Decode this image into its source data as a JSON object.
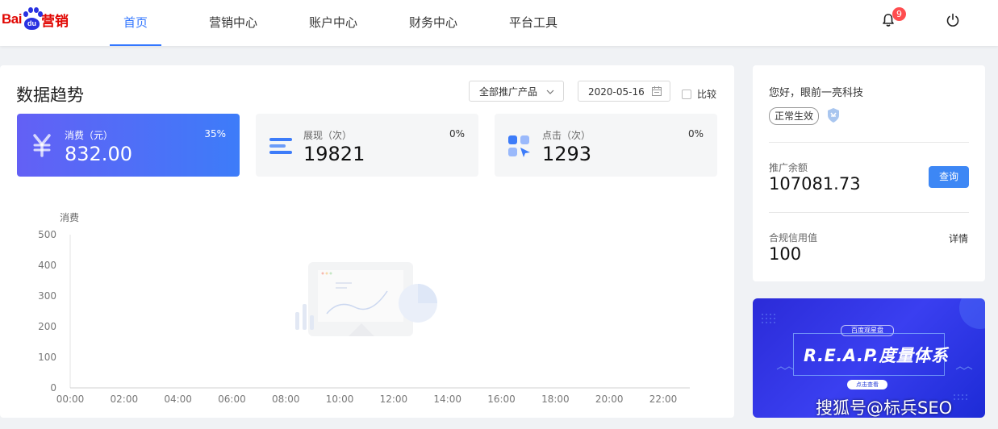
{
  "brand": {
    "logo_bai": "Bai",
    "logo_du": "du",
    "logo_cn": "营销"
  },
  "nav": {
    "items": [
      {
        "label": "首页",
        "active": true
      },
      {
        "label": "营销中心",
        "active": false
      },
      {
        "label": "账户中心",
        "active": false
      },
      {
        "label": "财务中心",
        "active": false
      },
      {
        "label": "平台工具",
        "active": false
      }
    ]
  },
  "header": {
    "notification_count": "9",
    "icons": [
      "bell-icon",
      "power-icon"
    ]
  },
  "trend": {
    "title": "数据趋势",
    "product_select": "全部推广产品",
    "date": "2020-05-16",
    "compare_label": "比较",
    "compare_checked": false
  },
  "cards": [
    {
      "label": "消费（元）",
      "value": "832.00",
      "percent": "35%",
      "icon": "yen-icon"
    },
    {
      "label": "展现（次）",
      "value": "19821",
      "percent": "0%",
      "icon": "list-icon"
    },
    {
      "label": "点击（次）",
      "value": "1293",
      "percent": "0%",
      "icon": "click-icon"
    }
  ],
  "chart_data": {
    "type": "line",
    "ylabel": "消费",
    "ylim": [
      0,
      500
    ],
    "yticks": [
      "0",
      "100",
      "200",
      "300",
      "400",
      "500"
    ],
    "categories": [
      "00:00",
      "02:00",
      "04:00",
      "06:00",
      "08:00",
      "10:00",
      "12:00",
      "14:00",
      "16:00",
      "18:00",
      "20:00",
      "22:00"
    ],
    "series": [],
    "grid": false
  },
  "account": {
    "greeting": "您好，眼前一亮科技",
    "status_tag": "正常生效",
    "balance_label": "推广余额",
    "balance_value": "107081.73",
    "query_button": "查询",
    "credit_label": "合规信用值",
    "credit_value": "100",
    "detail_link": "详情"
  },
  "banner": {
    "small_title": "百度观星盘",
    "headline": "R.E.A.P.度量体系",
    "cta": "点击查看",
    "watermark": "搜狐号@标兵SEO"
  },
  "colors": {
    "accent": "#3377ff",
    "card_gradient_start": "#6360f5",
    "card_gradient_end": "#3d7cf9",
    "badge": "#ff4d4f",
    "brand_red": "#e10602",
    "brand_blue": "#2932e1"
  }
}
